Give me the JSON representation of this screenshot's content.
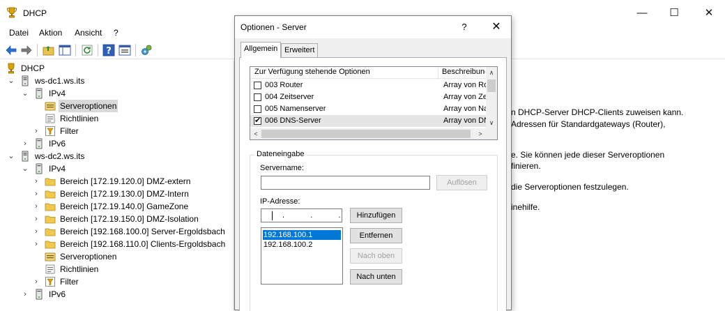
{
  "window": {
    "title": "DHCP",
    "controls": {
      "minimize": "—",
      "maximize": "☐",
      "close": "✕"
    }
  },
  "menu": {
    "items": [
      "Datei",
      "Aktion",
      "Ansicht",
      "?"
    ]
  },
  "toolbar": {
    "icons": [
      "back-arrow-icon",
      "forward-arrow-icon",
      "up-folder-icon",
      "show-hide-tree-icon",
      "refresh-icon",
      "help-icon",
      "properties-icon",
      "dhcp-server-icon"
    ]
  },
  "tree": {
    "root": "DHCP",
    "server1": "ws-dc1.ws.its",
    "s1_ipv4": "IPv4",
    "s1_serveroptionen": "Serveroptionen",
    "s1_richtlinien": "Richtlinien",
    "s1_filter": "Filter",
    "s1_ipv6": "IPv6",
    "server2": "ws-dc2.ws.its",
    "s2_ipv4": "IPv4",
    "scopes": [
      "Bereich [172.19.120.0] DMZ-extern",
      "Bereich [172.19.130.0] DMZ-Intern",
      "Bereich [172.19.140.0] GameZone",
      "Bereich [172.19.150.0] DMZ-Isolation",
      "Bereich [192.168.100.0] Server-Ergoldsbach",
      "Bereich [192.168.110.0] Clients-Ergoldsbach"
    ],
    "s2_serveroptionen": "Serveroptionen",
    "s2_richtlinien": "Richtlinien",
    "s2_filter": "Filter",
    "s2_ipv6": "IPv6"
  },
  "right_pane": {
    "lines": [
      "n DHCP-Server DHCP-Clients zuweisen kann.",
      "Adressen für Standardgateways (Router),",
      "e. Sie können jede dieser Serveroptionen",
      "finieren.",
      "die Serveroptionen festzulegen.",
      "inehilfe."
    ]
  },
  "dialog": {
    "title": "Optionen - Server",
    "help": "?",
    "close": "✕",
    "tabs": [
      "Allgemein",
      "Erweitert"
    ],
    "options_list": {
      "col_name": "Zur Verfügung stehende Optionen",
      "col_desc": "Beschreibung",
      "rows": [
        {
          "name": "003 Router",
          "desc": "Array von Ro",
          "checked": false
        },
        {
          "name": "004 Zeitserver",
          "desc": "Array von Ze",
          "checked": false
        },
        {
          "name": "005 Namenserver",
          "desc": "Array von Na",
          "checked": false
        },
        {
          "name": "006 DNS-Server",
          "desc": "Array von DN",
          "checked": true
        }
      ]
    },
    "data_entry": {
      "legend": "Dateneingabe",
      "servername_label": "Servername:",
      "servername_value": "",
      "resolve_button": "Auflösen",
      "ip_label": "IP-Adresse:",
      "ip_value": ".   .   .",
      "add_button": "Hinzufügen",
      "remove_button": "Entfernen",
      "up_button": "Nach oben",
      "down_button": "Nach unten",
      "ip_list": [
        "192.168.100.1",
        "192.168.100.2"
      ]
    }
  }
}
